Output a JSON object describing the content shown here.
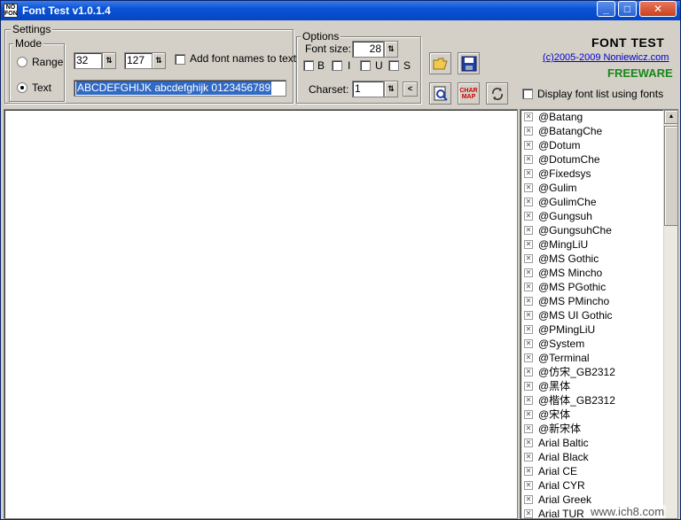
{
  "window": {
    "title": "Font Test v1.0.1.4",
    "icon_text": "NO FONT"
  },
  "settings": {
    "label": "Settings",
    "mode": {
      "label": "Mode",
      "range_label": "Range",
      "text_label": "Text",
      "selected": "Text"
    },
    "range_from": "32",
    "range_to": "127",
    "add_font_names_label": "Add font names to text",
    "sample_text": "ABCDEFGHIJK abcdefghijk 0123456789"
  },
  "options": {
    "label": "Options",
    "font_size_label": "Font size:",
    "font_size_value": "28",
    "bold_label": "B",
    "italic_label": "I",
    "underline_label": "U",
    "strike_label": "S",
    "charset_label": "Charset:",
    "charset_value": "1",
    "charset_btn": "<"
  },
  "toolbar": {
    "open_icon": "folder-open-icon",
    "save_icon": "floppy-disk-icon",
    "preview_icon": "print-preview-icon",
    "charmap_label": "CHAR MAP",
    "refresh_icon": "refresh-icon",
    "display_font_list_label": "Display font list using fonts"
  },
  "brand": {
    "title": "FONT TEST",
    "link": "(c)2005-2009 Noniewicz.com",
    "freeware": "FREEWARE"
  },
  "font_list": [
    "@Batang",
    "@BatangChe",
    "@Dotum",
    "@DotumChe",
    "@Fixedsys",
    "@Gulim",
    "@GulimChe",
    "@Gungsuh",
    "@GungsuhChe",
    "@MingLiU",
    "@MS Gothic",
    "@MS Mincho",
    "@MS PGothic",
    "@MS PMincho",
    "@MS UI Gothic",
    "@PMingLiU",
    "@System",
    "@Terminal",
    "@仿宋_GB2312",
    "@黑体",
    "@楷体_GB2312",
    "@宋体",
    "@新宋体",
    "Arial Baltic",
    "Arial Black",
    "Arial CE",
    "Arial CYR",
    "Arial Greek",
    "Arial TUR"
  ],
  "watermark": "www.ich8.com"
}
